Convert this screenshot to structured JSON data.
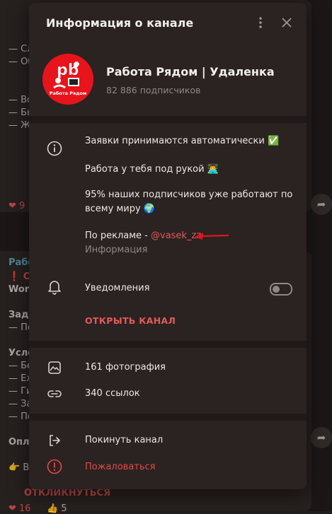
{
  "background": {
    "lines_top": [
      "— Сл",
      "— Об",
      "— Во",
      "— Бы",
      "— Же"
    ],
    "reactions_top": "9",
    "lines_bottom_heading": "Рабо",
    "lines_bottom_sub": "Сро",
    "lines_bottom_word": "Word",
    "lines_bottom_task": "Зада",
    "lines_bottom_cond": "Усло",
    "lines_bottom_pay": "Опла",
    "cta": "ОТКЛИКНУТЬСЯ",
    "reaction1": "16",
    "reaction2": "5"
  },
  "modal": {
    "title": "Информация о канале",
    "channel_name": "Работа Рядом | Удаленка",
    "subscribers": "82 886 подписчиков",
    "avatar_text": "Работа Рядом",
    "description": {
      "line1": "Заявки принимаются автоматически ✅",
      "line2": "Работа у тебя под рукой 👨‍💻",
      "line3a": "95% наших подписчиков уже работают по",
      "line3b": "всему миру 🌍",
      "ads_prefix": "По рекламе - ",
      "ads_handle": "@vasek_zz",
      "caption": "Информация"
    },
    "notifications_label": "Уведомления",
    "notifications_on": false,
    "open_channel": "ОТКРЫТЬ КАНАЛ",
    "photos": "161 фотография",
    "links": "340 ссылок",
    "leave": "Покинуть канал",
    "report": "Пожаловаться"
  },
  "colors": {
    "accent_red": "#e35a5a",
    "avatar_red": "#e7141c",
    "arrow_red": "#e0141c"
  }
}
